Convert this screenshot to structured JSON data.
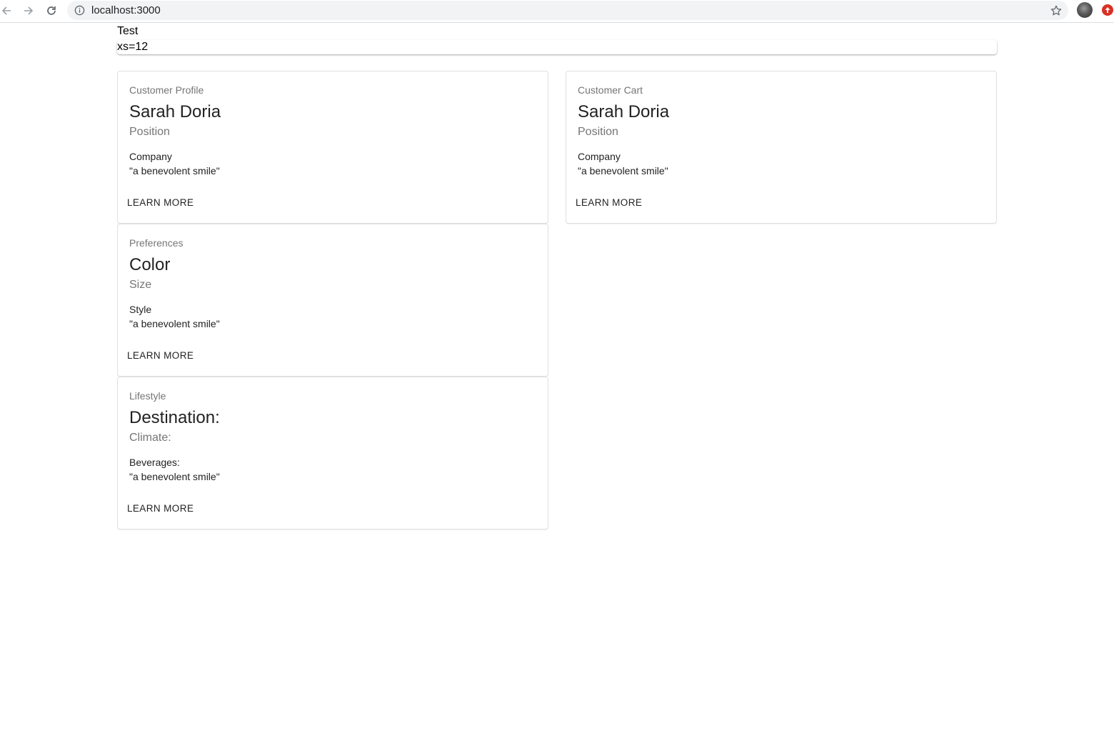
{
  "browser": {
    "url": "localhost:3000"
  },
  "page": {
    "title": "Test",
    "grid_label": "xs=12"
  },
  "cards": [
    {
      "overline": "Customer Profile",
      "title": "Sarah Doria",
      "subtitle": "Position",
      "line1": "Company",
      "line2": "\"a benevolent smile\"",
      "action": "LEARN MORE"
    },
    {
      "overline": "Customer Cart",
      "title": "Sarah Doria",
      "subtitle": "Position",
      "line1": "Company",
      "line2": "\"a benevolent smile\"",
      "action": "LEARN MORE"
    },
    {
      "overline": "Preferences",
      "title": "Color",
      "subtitle": "Size",
      "line1": "Style",
      "line2": "\"a benevolent smile\"",
      "action": "LEARN MORE"
    },
    {
      "overline": "Lifestyle",
      "title": "Destination:",
      "subtitle": "Climate:",
      "line1": "Beverages:",
      "line2": "\"a benevolent smile\"",
      "action": "LEARN MORE"
    }
  ]
}
